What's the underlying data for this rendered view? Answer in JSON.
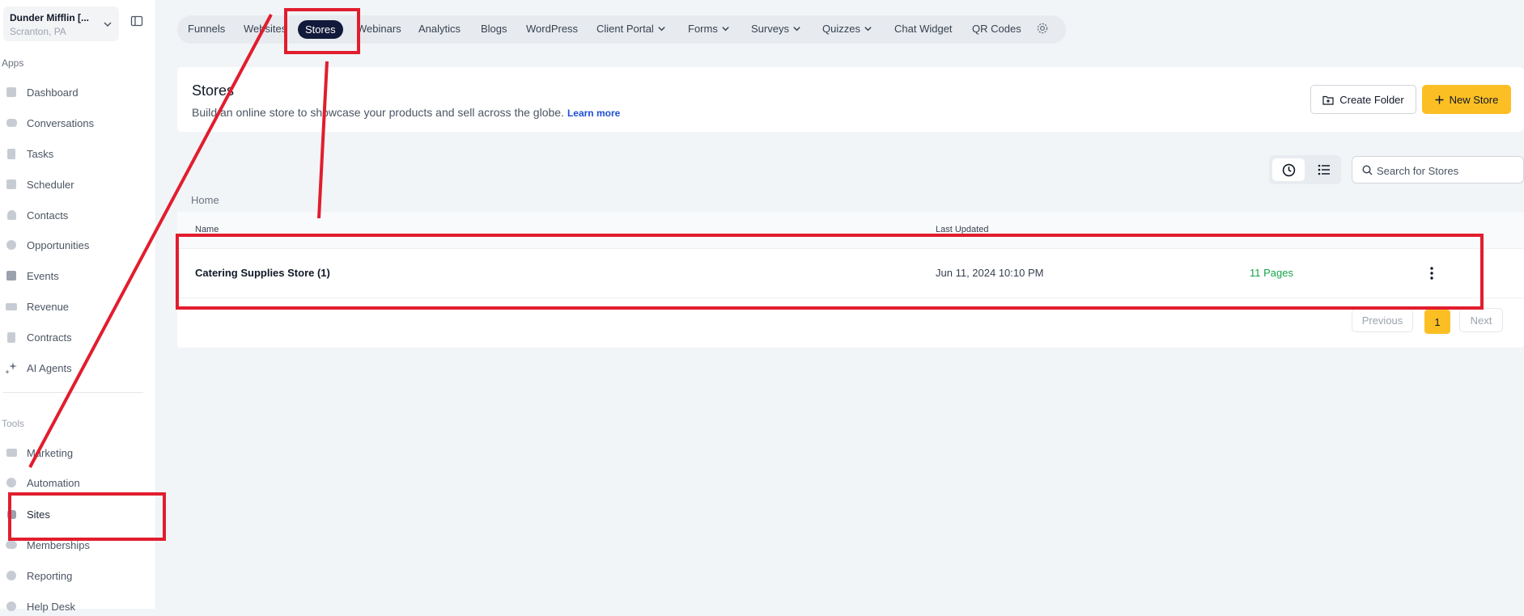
{
  "account": {
    "name": "Dunder Mifflin [...",
    "location": "Scranton, PA"
  },
  "sidebar": {
    "apps_label": "Apps",
    "tools_label": "Tools",
    "apps": [
      {
        "label": "Dashboard",
        "icon": "dashboard-icon"
      },
      {
        "label": "Conversations",
        "icon": "conversations-icon"
      },
      {
        "label": "Tasks",
        "icon": "tasks-icon"
      },
      {
        "label": "Scheduler",
        "icon": "calendar-icon"
      },
      {
        "label": "Contacts",
        "icon": "contacts-icon"
      },
      {
        "label": "Opportunities",
        "icon": "opportunities-icon"
      },
      {
        "label": "Events",
        "icon": "events-icon"
      },
      {
        "label": "Revenue",
        "icon": "revenue-icon"
      },
      {
        "label": "Contracts",
        "icon": "contracts-icon"
      },
      {
        "label": "AI Agents",
        "icon": "sparkle-icon"
      }
    ],
    "tools": [
      {
        "label": "Marketing",
        "icon": "megaphone-icon"
      },
      {
        "label": "Automation",
        "icon": "automation-icon"
      },
      {
        "label": "Sites",
        "icon": "sites-icon"
      },
      {
        "label": "Memberships",
        "icon": "memberships-icon"
      },
      {
        "label": "Reporting",
        "icon": "reporting-icon"
      },
      {
        "label": "Help Desk",
        "icon": "help-desk-icon"
      }
    ]
  },
  "topnav": {
    "items": [
      "Funnels",
      "Websites",
      "Stores",
      "Webinars",
      "Analytics",
      "Blogs",
      "WordPress",
      "Client Portal",
      "Forms",
      "Surveys",
      "Quizzes",
      "Chat Widget",
      "QR Codes"
    ],
    "active": "Stores"
  },
  "header": {
    "title": "Stores",
    "subtitle": "Build an online store to showcase your products and sell across the globe.",
    "learn_more": "Learn more",
    "create_folder": "Create Folder",
    "new_store": "New Store"
  },
  "search": {
    "placeholder": "Search for Stores"
  },
  "breadcrumb": "Home",
  "table": {
    "columns": [
      "Name",
      "Last Updated"
    ],
    "rows": [
      {
        "name": "Catering Supplies Store (1)",
        "last_updated": "Jun 11, 2024 10:10 PM",
        "pages": "11 Pages"
      }
    ]
  },
  "pagination": {
    "previous": "Previous",
    "current": "1",
    "next": "Next"
  },
  "colors": {
    "accent": "#fbbf24",
    "active_tab": "#111a3a",
    "annotation": "#e11d2e",
    "pages_green": "#16a34a"
  }
}
